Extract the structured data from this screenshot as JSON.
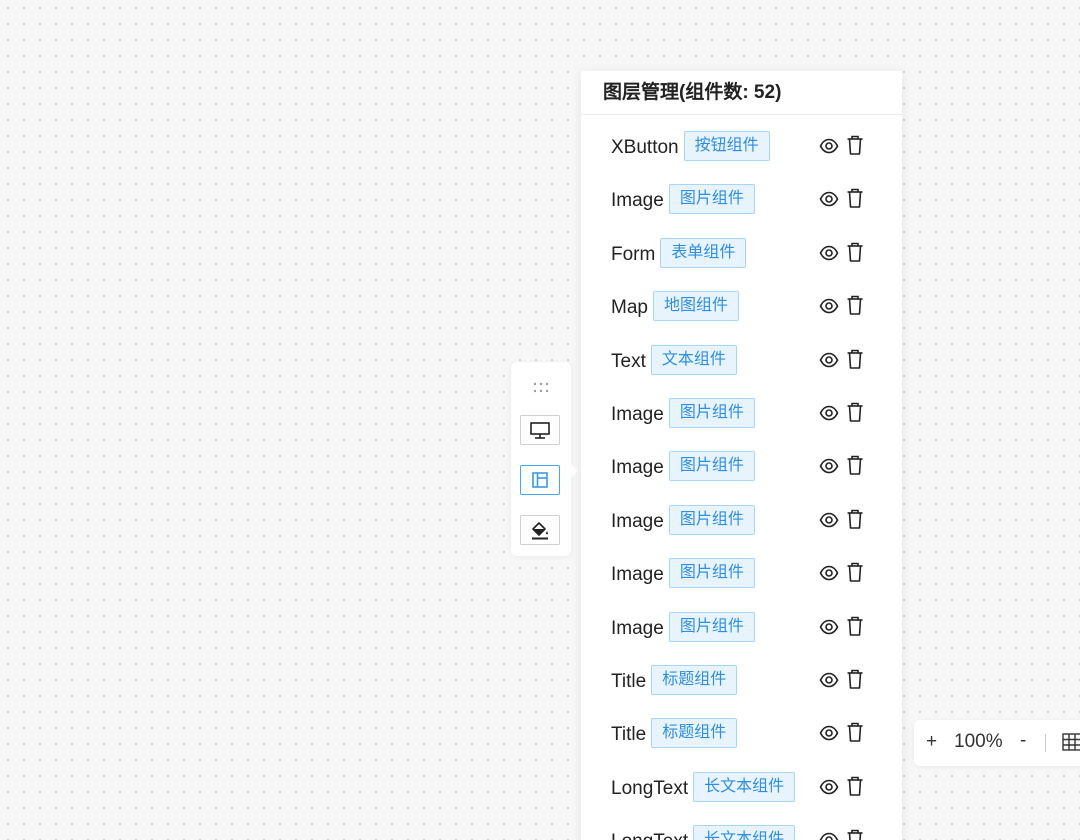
{
  "panel": {
    "title": "图层管理(组件数: 52)",
    "layers": [
      {
        "name": "XButton",
        "tag": "按钮组件"
      },
      {
        "name": "Image",
        "tag": "图片组件"
      },
      {
        "name": "Form",
        "tag": "表单组件"
      },
      {
        "name": "Map",
        "tag": "地图组件"
      },
      {
        "name": "Text",
        "tag": "文本组件"
      },
      {
        "name": "Image",
        "tag": "图片组件"
      },
      {
        "name": "Image",
        "tag": "图片组件"
      },
      {
        "name": "Image",
        "tag": "图片组件"
      },
      {
        "name": "Image",
        "tag": "图片组件"
      },
      {
        "name": "Image",
        "tag": "图片组件"
      },
      {
        "name": "Title",
        "tag": "标题组件"
      },
      {
        "name": "Title",
        "tag": "标题组件"
      },
      {
        "name": "LongText",
        "tag": "长文本组件"
      },
      {
        "name": "LongText",
        "tag": "长文本组件"
      }
    ]
  },
  "toolbar": {
    "icons": [
      "grip-icon",
      "monitor-icon",
      "layers-icon",
      "paint-bucket-icon"
    ],
    "active_index": 1
  },
  "zoom": {
    "plus": "+",
    "level": "100%",
    "minus": "-"
  },
  "colors": {
    "accent": "#2f8ee0",
    "tag_bg": "#e8f4fd",
    "tag_border": "#a8d4f5",
    "active_border": "#4aa5f0"
  }
}
